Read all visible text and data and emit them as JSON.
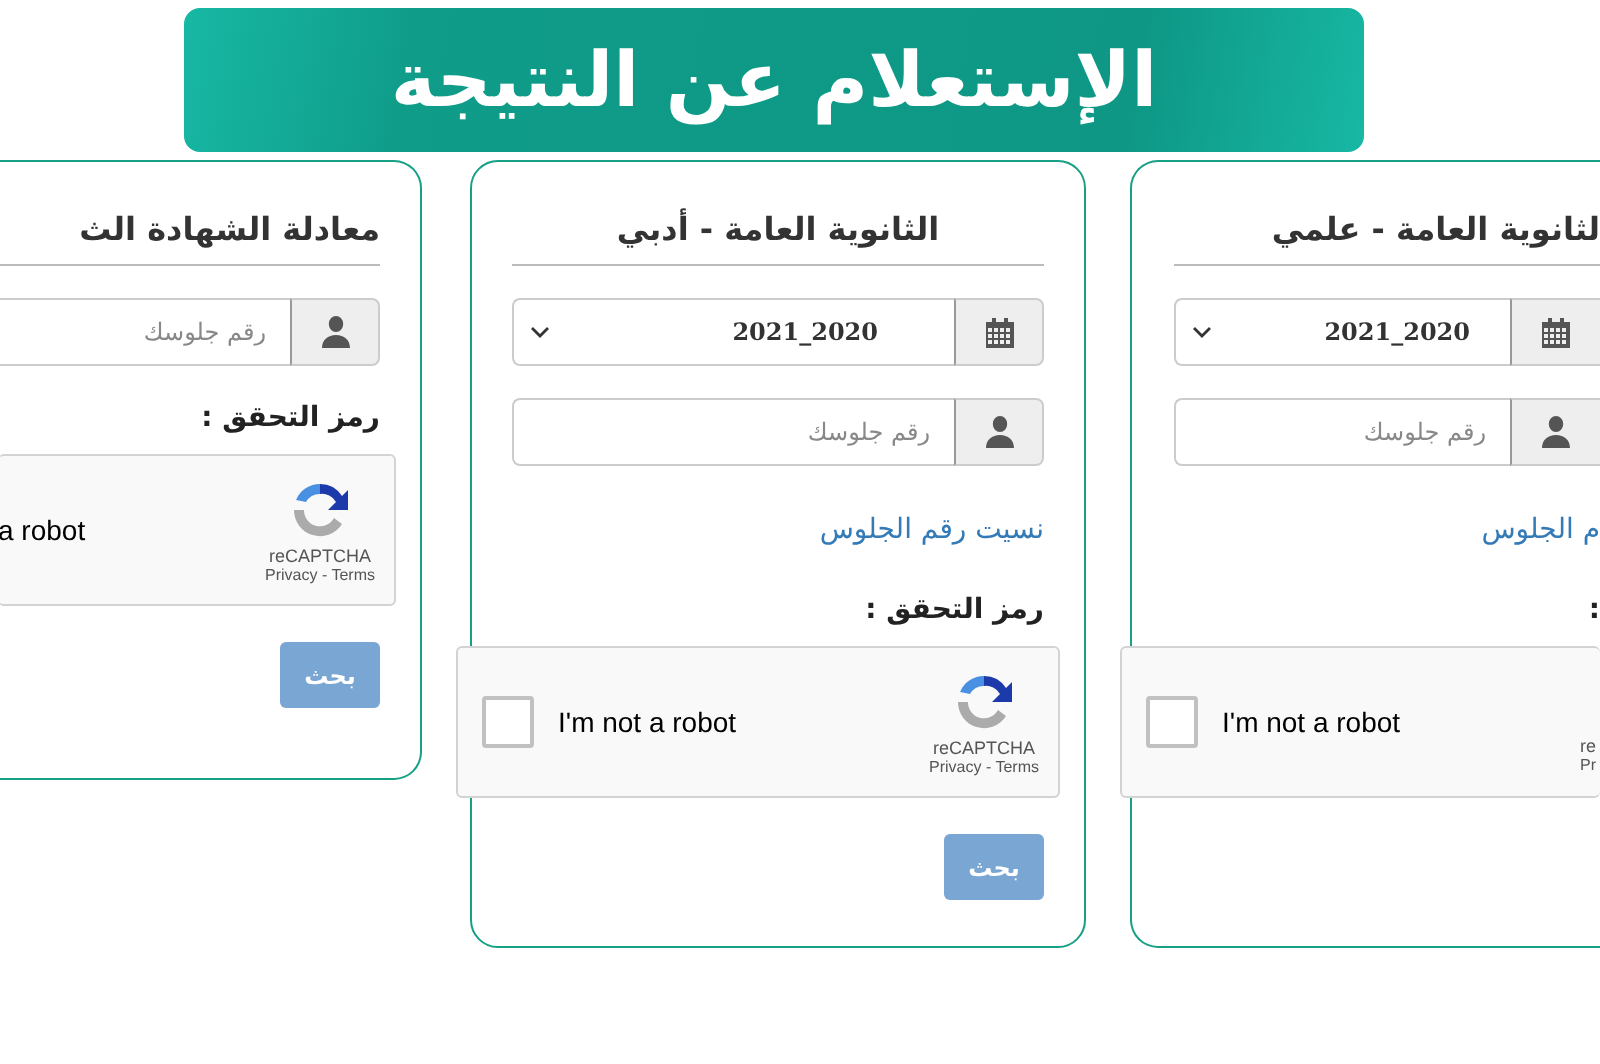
{
  "banner": {
    "title": "الإستعلام عن النتيجة"
  },
  "cards": [
    {
      "title": "لثانوية العامة - علمي",
      "year": "2021_2020",
      "seat_placeholder": "رقم جلوسك",
      "forgot_link": "م الجلوس",
      "captcha_label": ":",
      "captcha": {
        "checked": false,
        "text": "I'm not a robot",
        "brand": "re",
        "links": "Pr"
      }
    },
    {
      "title": "الثانوية العامة - أدبي",
      "year": "2021_2020",
      "seat_placeholder": "رقم جلوسك",
      "forgot_link": "نسيت رقم الجلوس",
      "captcha_label": "رمز التحقق :",
      "captcha": {
        "checked": false,
        "text": "I'm not a robot",
        "brand": "reCAPTCHA",
        "links": "Privacy - Terms"
      },
      "button": "بحث"
    },
    {
      "title": "معادلة الشهادة الث",
      "seat_placeholder": "رقم جلوسك",
      "captcha_label": "رمز التحقق :",
      "captcha": {
        "text": "a robot",
        "brand": "reCAPTCHA",
        "links": "Privacy - Terms"
      },
      "button": "بحث"
    }
  ]
}
